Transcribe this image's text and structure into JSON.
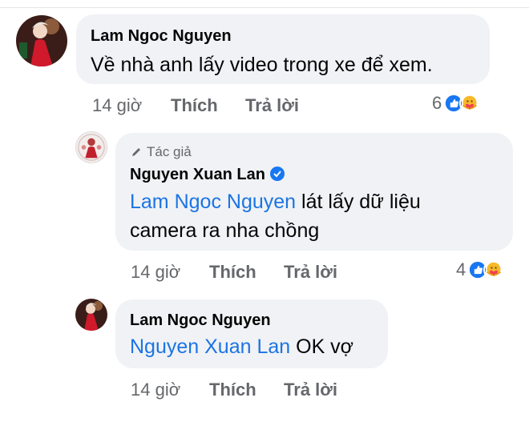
{
  "comments": [
    {
      "author": "Lam Ngoc Nguyen",
      "text": "Về nhà anh lấy video trong xe để xem.",
      "time": "14 giờ",
      "like_label": "Thích",
      "reply_label": "Trả lời",
      "reaction_count": "6"
    },
    {
      "badge": "Tác giả",
      "author": "Nguyen Xuan Lan",
      "mention": "Lam Ngoc Nguyen",
      "text_line1": " lát lấy dữ liệu",
      "text_line2": "camera ra nha chồng",
      "time": "14 giờ",
      "like_label": "Thích",
      "reply_label": "Trả lời",
      "reaction_count": "4"
    },
    {
      "author": "Lam Ngoc Nguyen",
      "mention": "Nguyen Xuan Lan",
      "text": " OK vợ",
      "time": "14 giờ",
      "like_label": "Thích",
      "reply_label": "Trả lời"
    }
  ],
  "colors": {
    "bubble": "#f0f2f5",
    "mention": "#1b74e4",
    "muted": "#65676b",
    "like_blue": "#1877f2",
    "care_yellow": "#f7b928"
  },
  "icons": [
    "like-reaction-icon",
    "care-reaction-icon",
    "pencil-icon",
    "verified-badge-icon"
  ]
}
